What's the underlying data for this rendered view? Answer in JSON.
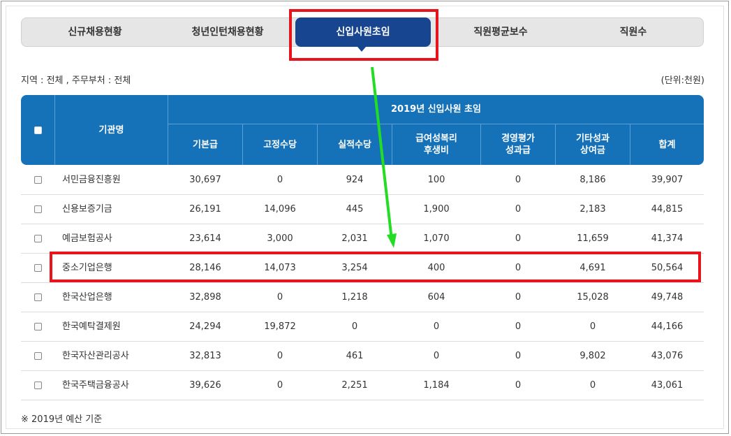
{
  "tabs": [
    {
      "label": "신규채용현황"
    },
    {
      "label": "청년인턴채용현황"
    },
    {
      "label": "신입사원초임"
    },
    {
      "label": "직원평균보수"
    },
    {
      "label": "직원수"
    }
  ],
  "filter_text": "지역 : 전체 , 주무부처 : 전체",
  "unit_text": "(단위:천원)",
  "table": {
    "name_header": "기관명",
    "group_header": "2019년 신입사원 초임",
    "columns": [
      "기본급",
      "고정수당",
      "실적수당",
      "급여성복리\n후생비",
      "경영평가\n성과급",
      "기타성과\n상여금",
      "합계"
    ],
    "rows": [
      {
        "name": "서민금융진흥원",
        "values": [
          "30,697",
          "0",
          "924",
          "100",
          "0",
          "8,186",
          "39,907"
        ]
      },
      {
        "name": "신용보증기금",
        "values": [
          "26,191",
          "14,096",
          "445",
          "1,900",
          "0",
          "2,183",
          "44,815"
        ]
      },
      {
        "name": "예금보험공사",
        "values": [
          "23,614",
          "3,000",
          "2,031",
          "1,070",
          "0",
          "11,659",
          "41,374"
        ]
      },
      {
        "name": "중소기업은행",
        "values": [
          "28,146",
          "14,073",
          "3,254",
          "400",
          "0",
          "4,691",
          "50,564"
        ]
      },
      {
        "name": "한국산업은행",
        "values": [
          "32,898",
          "0",
          "1,218",
          "604",
          "0",
          "15,028",
          "49,748"
        ]
      },
      {
        "name": "한국예탁결제원",
        "values": [
          "24,294",
          "19,872",
          "0",
          "0",
          "0",
          "0",
          "44,166"
        ]
      },
      {
        "name": "한국자산관리공사",
        "values": [
          "32,813",
          "0",
          "461",
          "0",
          "0",
          "9,802",
          "43,076"
        ]
      },
      {
        "name": "한국주택금융공사",
        "values": [
          "39,626",
          "0",
          "2,251",
          "1,184",
          "0",
          "0",
          "43,061"
        ]
      }
    ]
  },
  "footnote": "※ 2019년 예산 기준",
  "colors": {
    "tab_active": "#17458f",
    "table_header": "#1572b8",
    "highlight": "#e8141c",
    "arrow": "#22dd22"
  }
}
